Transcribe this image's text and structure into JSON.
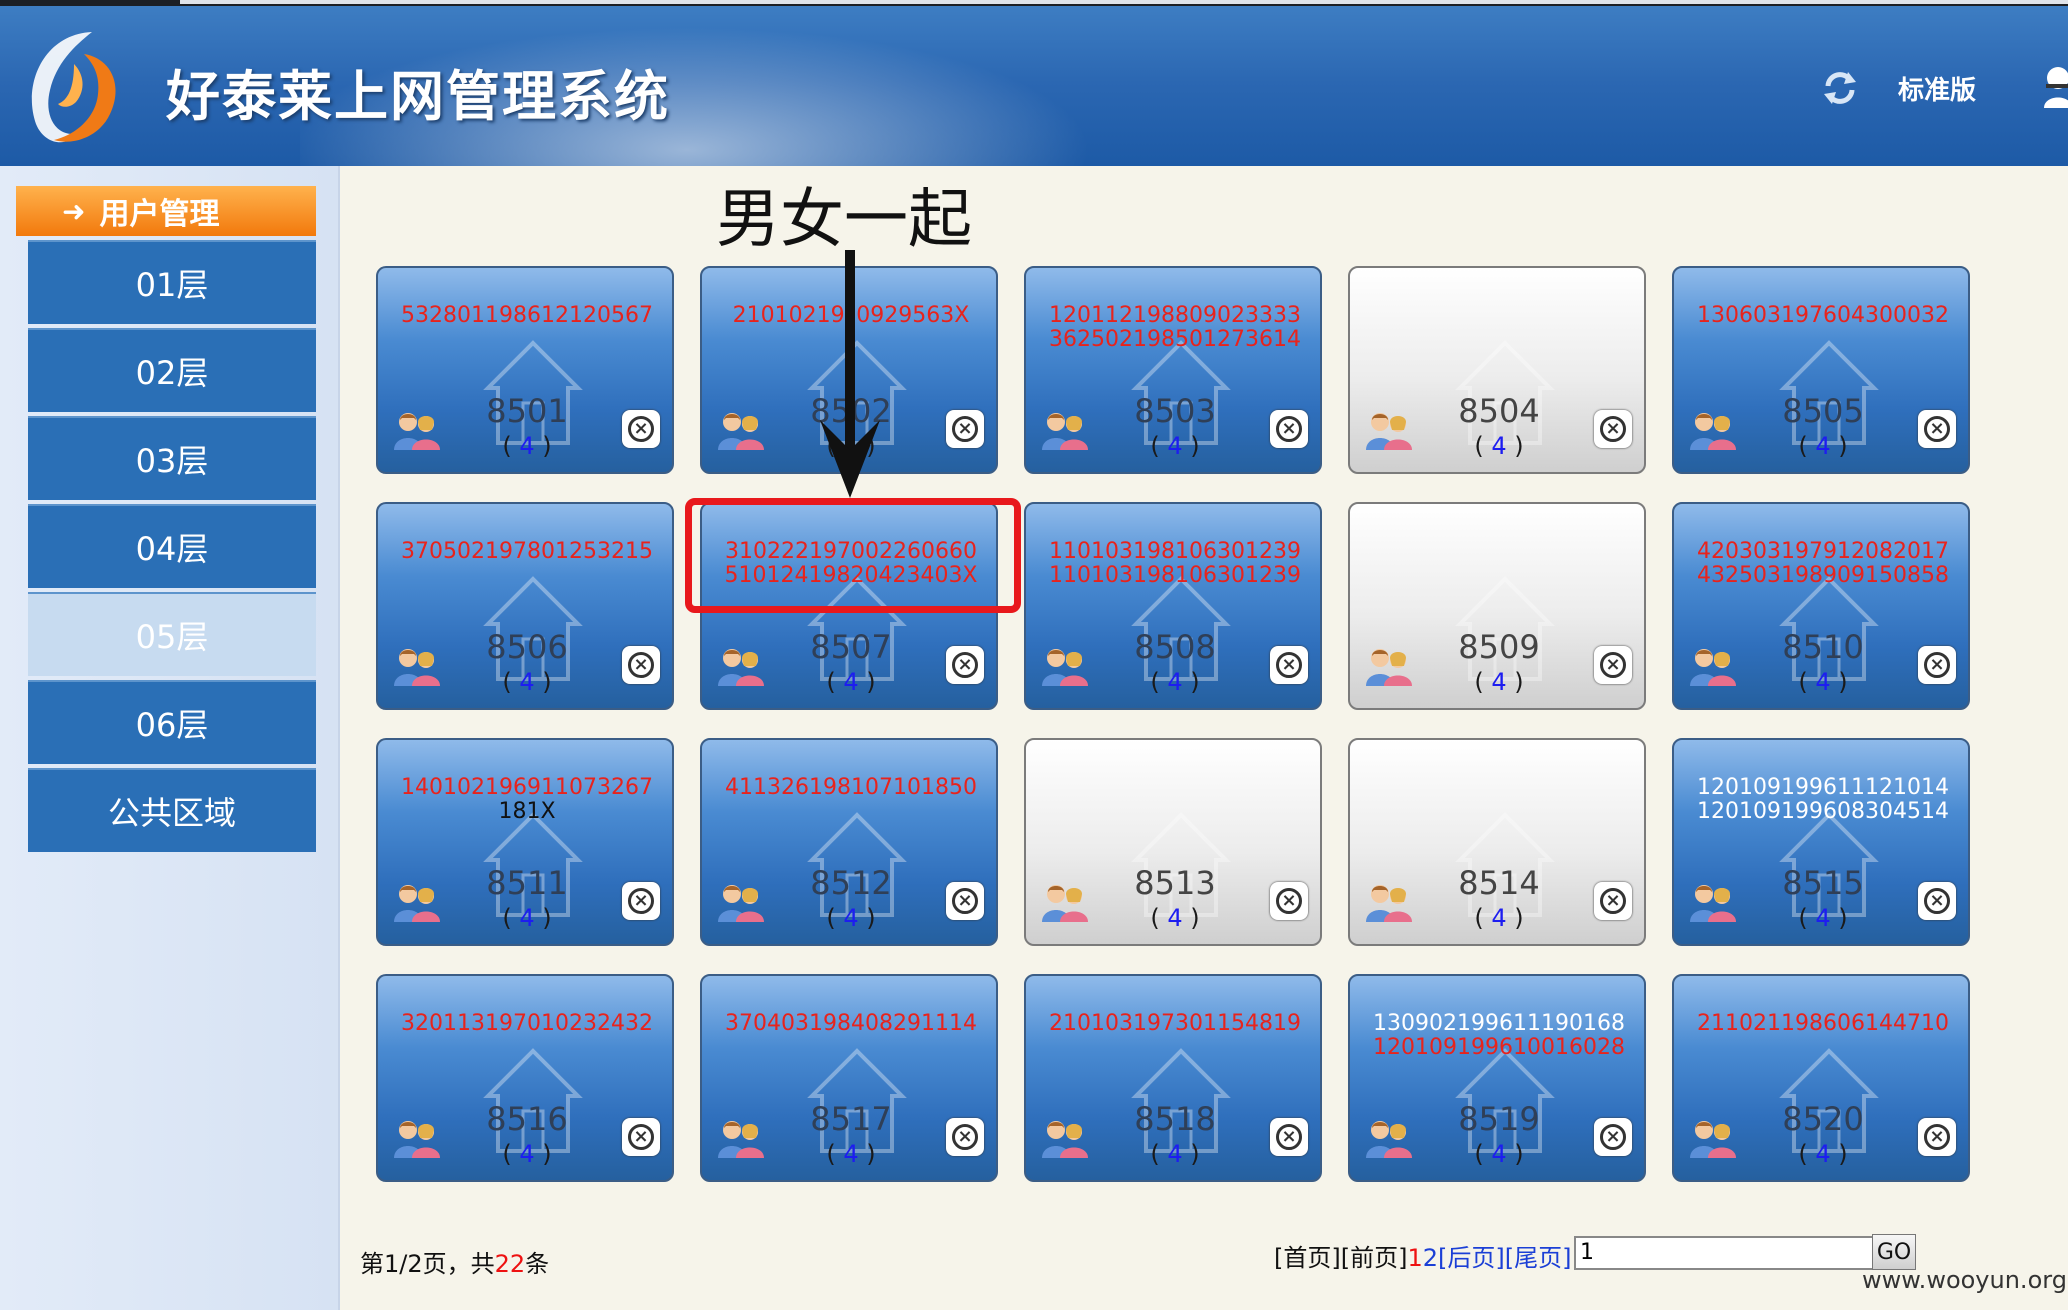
{
  "header": {
    "app_title": "好泰莱上网管理系统",
    "edition": "标准版"
  },
  "sidebar": {
    "section_title": "用户管理",
    "items": [
      {
        "label": "01层",
        "active": false
      },
      {
        "label": "02层",
        "active": false
      },
      {
        "label": "03层",
        "active": false
      },
      {
        "label": "04层",
        "active": false
      },
      {
        "label": "05层",
        "active": true
      },
      {
        "label": "06层",
        "active": false
      },
      {
        "label": "公共区域",
        "active": false
      }
    ]
  },
  "annotation": {
    "text": "男女一起"
  },
  "rooms": [
    {
      "room": "8501",
      "count": "4",
      "style": "blue",
      "ids": [
        "532801198612120567"
      ]
    },
    {
      "room": "8502",
      "count": "4",
      "style": "blue",
      "ids": [
        "21010219?0929563X"
      ]
    },
    {
      "room": "8503",
      "count": "4",
      "style": "blue",
      "ids": [
        "120112198809023333",
        "362502198501273614"
      ]
    },
    {
      "room": "8504",
      "count": "4",
      "style": "gray",
      "ids": []
    },
    {
      "room": "8505",
      "count": "4",
      "style": "blue",
      "ids": [
        "130603197604300032"
      ]
    },
    {
      "room": "8506",
      "count": "4",
      "style": "blue",
      "ids": [
        "370502197801253215"
      ]
    },
    {
      "room": "8507",
      "count": "4",
      "style": "blue",
      "ids": [
        "310222197002260660",
        "51012419820423403X"
      ]
    },
    {
      "room": "8508",
      "count": "4",
      "style": "blue",
      "ids": [
        "110103198106301239",
        "110103198106301239"
      ]
    },
    {
      "room": "8509",
      "count": "4",
      "style": "gray",
      "ids": []
    },
    {
      "room": "8510",
      "count": "4",
      "style": "blue",
      "ids": [
        "420303197912082017",
        "432503198909150858"
      ]
    },
    {
      "room": "8511",
      "count": "4",
      "style": "blue",
      "ids": [
        "140102196911073267",
        "181X"
      ]
    },
    {
      "room": "8512",
      "count": "4",
      "style": "blue",
      "ids": [
        "411326198107101850"
      ]
    },
    {
      "room": "8513",
      "count": "4",
      "style": "gray",
      "ids": []
    },
    {
      "room": "8514",
      "count": "4",
      "style": "gray",
      "ids": []
    },
    {
      "room": "8515",
      "count": "4",
      "style": "blue",
      "ids": [
        "120109199611121014",
        "120109199608304514"
      ],
      "white": true
    },
    {
      "room": "8516",
      "count": "4",
      "style": "blue",
      "ids": [
        "320113197010232432"
      ]
    },
    {
      "room": "8517",
      "count": "4",
      "style": "blue",
      "ids": [
        "370403198408291114"
      ]
    },
    {
      "room": "8518",
      "count": "4",
      "style": "blue",
      "ids": [
        "210103197301154819"
      ]
    },
    {
      "room": "8519",
      "count": "4",
      "style": "blue",
      "ids": [
        "130902199611190168",
        "120109199610016028"
      ],
      "first_white": true
    },
    {
      "room": "8520",
      "count": "4",
      "style": "blue",
      "ids": [
        "211021198606144710"
      ]
    }
  ],
  "footer": {
    "page_prefix": "第1/2页，共",
    "total": "22",
    "page_suffix": "条",
    "first": "[首页]",
    "prev": "[前页]",
    "page1": "1",
    "page2": "2",
    "next": "[后页]",
    "last": "[尾页]",
    "input_value": "1",
    "go": "GO",
    "watermark": "www.wooyun.org"
  },
  "colors": {
    "tile_blue": "#2f6fbc",
    "id_red": "#e8231c",
    "sidebar_blue": "#2a6fb6",
    "accent_orange": "#f2790c",
    "annotation_red": "#e8181c"
  }
}
